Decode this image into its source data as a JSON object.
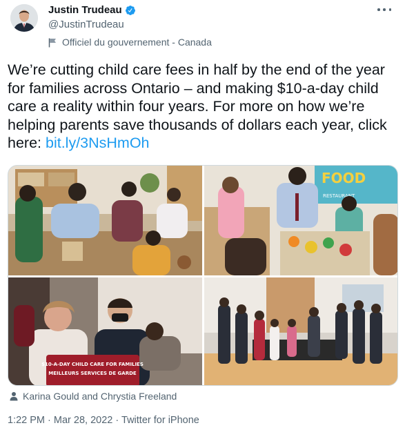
{
  "author": {
    "display_name": "Justin Trudeau",
    "handle": "@JustinTrudeau",
    "label": "Officiel du gouvernement - Canada",
    "verified": true
  },
  "tweet": {
    "text_before_link": "We’re cutting child care fees in half by the end of the year for families across Ontario – and making $10-a-day child care a reality within four years. For more on how we’re helping parents save thousands of dollars each year, click here: ",
    "link_text": "bit.ly/3NsHmOh"
  },
  "media": {
    "photo_count": 4,
    "banner_line1": "$10-A-DAY CHILD CARE FOR FAMILIES",
    "banner_line2": "MEILLEURS SERVICES DE GARDE",
    "wall_letters": "FOOD",
    "wall_word": "RESTAURANT"
  },
  "tagged_people": "Karina Gould and Chrystia Freeland",
  "meta": {
    "time": "1:22 PM",
    "separator": "·",
    "date": "Mar 28, 2022",
    "source": "Twitter for iPhone"
  },
  "colors": {
    "link": "#1d9bf0",
    "verified": "#1d9bf0",
    "secondary_text": "#536471",
    "primary_text": "#0f1419",
    "border": "#cfd9de"
  },
  "icons": [
    "verified-badge-icon",
    "government-flag-icon",
    "more-options-icon",
    "tag-person-icon"
  ]
}
